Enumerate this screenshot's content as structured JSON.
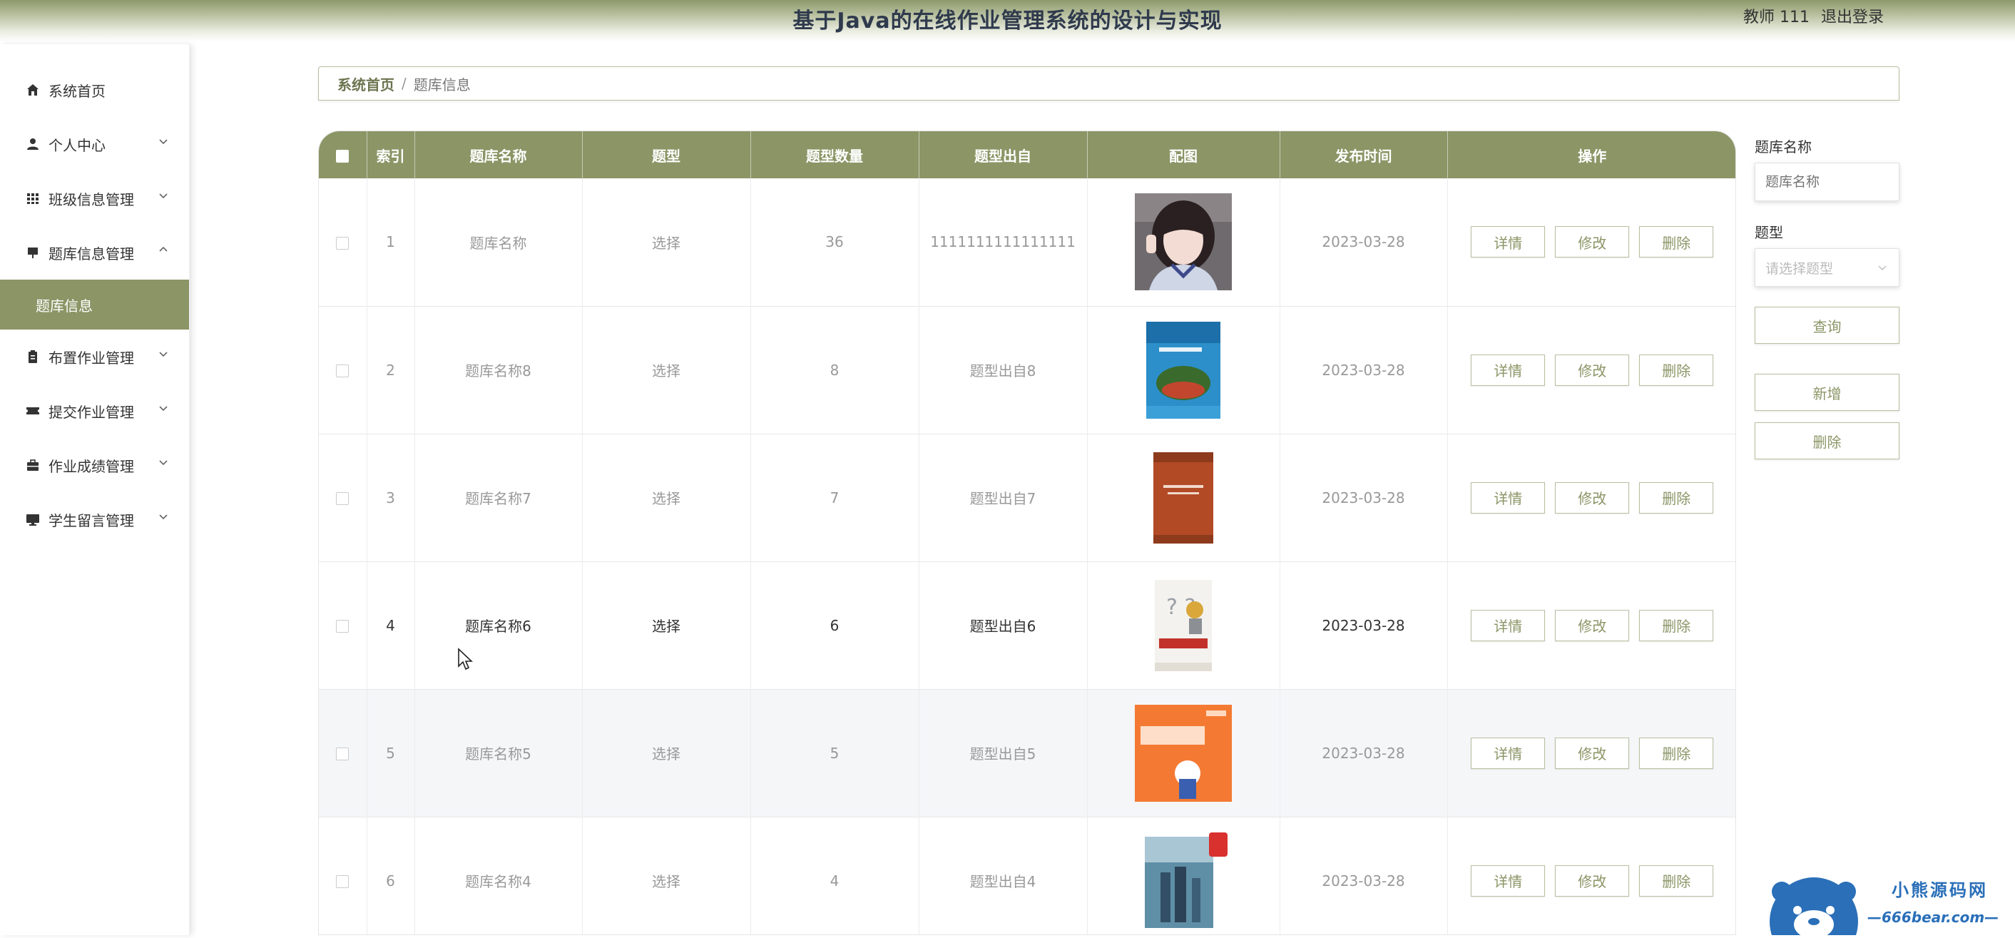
{
  "header": {
    "title": "基于Java的在线作业管理系统的设计与实现",
    "user_label": "教师 111",
    "logout_label": "退出登录"
  },
  "sidebar": {
    "items": [
      {
        "label": "系统首页",
        "icon": "home-icon"
      },
      {
        "label": "个人中心",
        "icon": "user-icon"
      },
      {
        "label": "班级信息管理",
        "icon": "grid-icon"
      },
      {
        "label": "题库信息管理",
        "icon": "book-icon"
      },
      {
        "label": "题库信息",
        "sub": true
      },
      {
        "label": "布置作业管理",
        "icon": "clipboard-icon"
      },
      {
        "label": "提交作业管理",
        "icon": "ticket-icon"
      },
      {
        "label": "作业成绩管理",
        "icon": "briefcase-icon"
      },
      {
        "label": "学生留言管理",
        "icon": "monitor-icon"
      }
    ]
  },
  "breadcrumb": {
    "home": "系统首页",
    "separator": "/",
    "current": "题库信息"
  },
  "table": {
    "headers": [
      "索引",
      "题库名称",
      "题型",
      "题型数量",
      "题型出自",
      "配图",
      "发布时间",
      "操作"
    ],
    "action_labels": {
      "detail": "详情",
      "edit": "修改",
      "delete": "删除"
    },
    "rows": [
      {
        "index": "1",
        "name": "题库名称",
        "type": "选择",
        "count": "36",
        "source": "1111111111111111",
        "image": "girl-photo",
        "date": "2023-03-28"
      },
      {
        "index": "2",
        "name": "题库名称8",
        "type": "选择",
        "count": "8",
        "source": "题型出自8",
        "image": "blue-book-cover",
        "date": "2023-03-28"
      },
      {
        "index": "3",
        "name": "题库名称7",
        "type": "选择",
        "count": "7",
        "source": "题型出自7",
        "image": "brown-book-cover",
        "date": "2023-03-28"
      },
      {
        "index": "4",
        "name": "题库名称6",
        "type": "选择",
        "count": "6",
        "source": "题型出自6",
        "image": "question-book-cover",
        "date": "2023-03-28"
      },
      {
        "index": "5",
        "name": "题库名称5",
        "type": "选择",
        "count": "5",
        "source": "题型出自5",
        "image": "orange-cet-book-cover",
        "date": "2023-03-28"
      },
      {
        "index": "6",
        "name": "题库名称4",
        "type": "选择",
        "count": "4",
        "source": "题型出自4",
        "image": "math-book-cover",
        "date": "2023-03-28"
      }
    ]
  },
  "search_panel": {
    "name_label": "题库名称",
    "name_placeholder": "题库名称",
    "type_label": "题型",
    "type_placeholder": "请选择题型",
    "query_label": "查询",
    "add_label": "新增",
    "delete_label": "删除"
  },
  "watermark": {
    "line1": "小熊源码网",
    "line2": "—666bear.com—"
  },
  "colors": {
    "accent": "#8b9566",
    "header_text": "#2f3a4d"
  }
}
